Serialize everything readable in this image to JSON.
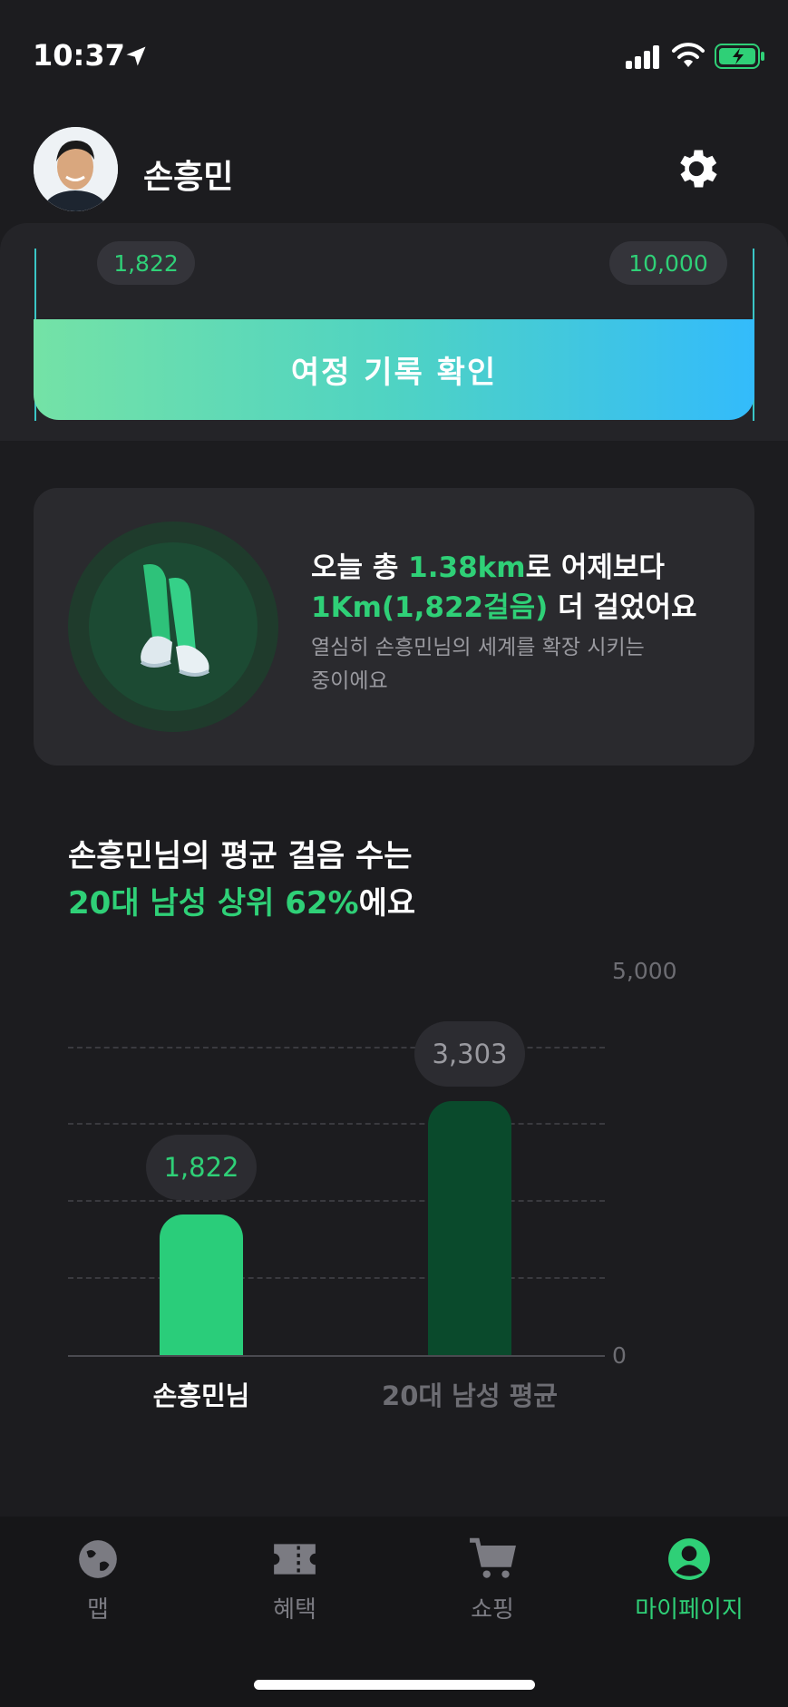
{
  "status_bar": {
    "time": "10:37"
  },
  "header": {
    "username": "손흥민"
  },
  "journey": {
    "current_steps": "1,822",
    "goal_steps": "10,000",
    "button_label": "여정 기록 확인"
  },
  "walk_summary": {
    "line1_prefix": "오늘 총 ",
    "line1_distance": "1.38km",
    "line1_suffix": "로 어제보다",
    "line2_highlight": "1Km(1,822걸음)",
    "line2_suffix": " 더 걸었어요",
    "sub_line1": "열심히 손흥민님의 세계를 확장 시키는",
    "sub_line2": "중이에요"
  },
  "ranking": {
    "title_line1": "손흥민님의 평균 걸음 수는",
    "title_highlight": "20대 남성 상위 62%",
    "title_suffix": "에요"
  },
  "chart_data": {
    "type": "bar",
    "categories": [
      "손흥민님",
      "20대 남성 평균"
    ],
    "values": [
      1822,
      3303
    ],
    "value_labels": [
      "1,822",
      "3,303"
    ],
    "ylim": [
      0,
      5000
    ],
    "y_tick_labels": [
      "5,000",
      "0"
    ],
    "grid": true,
    "colors": [
      "#2acd7a",
      "#0a4a2c"
    ]
  },
  "tabs": [
    {
      "label": "맵",
      "icon": "globe-icon",
      "active": false
    },
    {
      "label": "혜택",
      "icon": "ticket-icon",
      "active": false
    },
    {
      "label": "쇼핑",
      "icon": "cart-icon",
      "active": false
    },
    {
      "label": "마이페이지",
      "icon": "profile-icon",
      "active": true
    }
  ],
  "colors": {
    "accent": "#2fd077",
    "background": "#1c1c1f",
    "card": "#2a2a2e"
  }
}
